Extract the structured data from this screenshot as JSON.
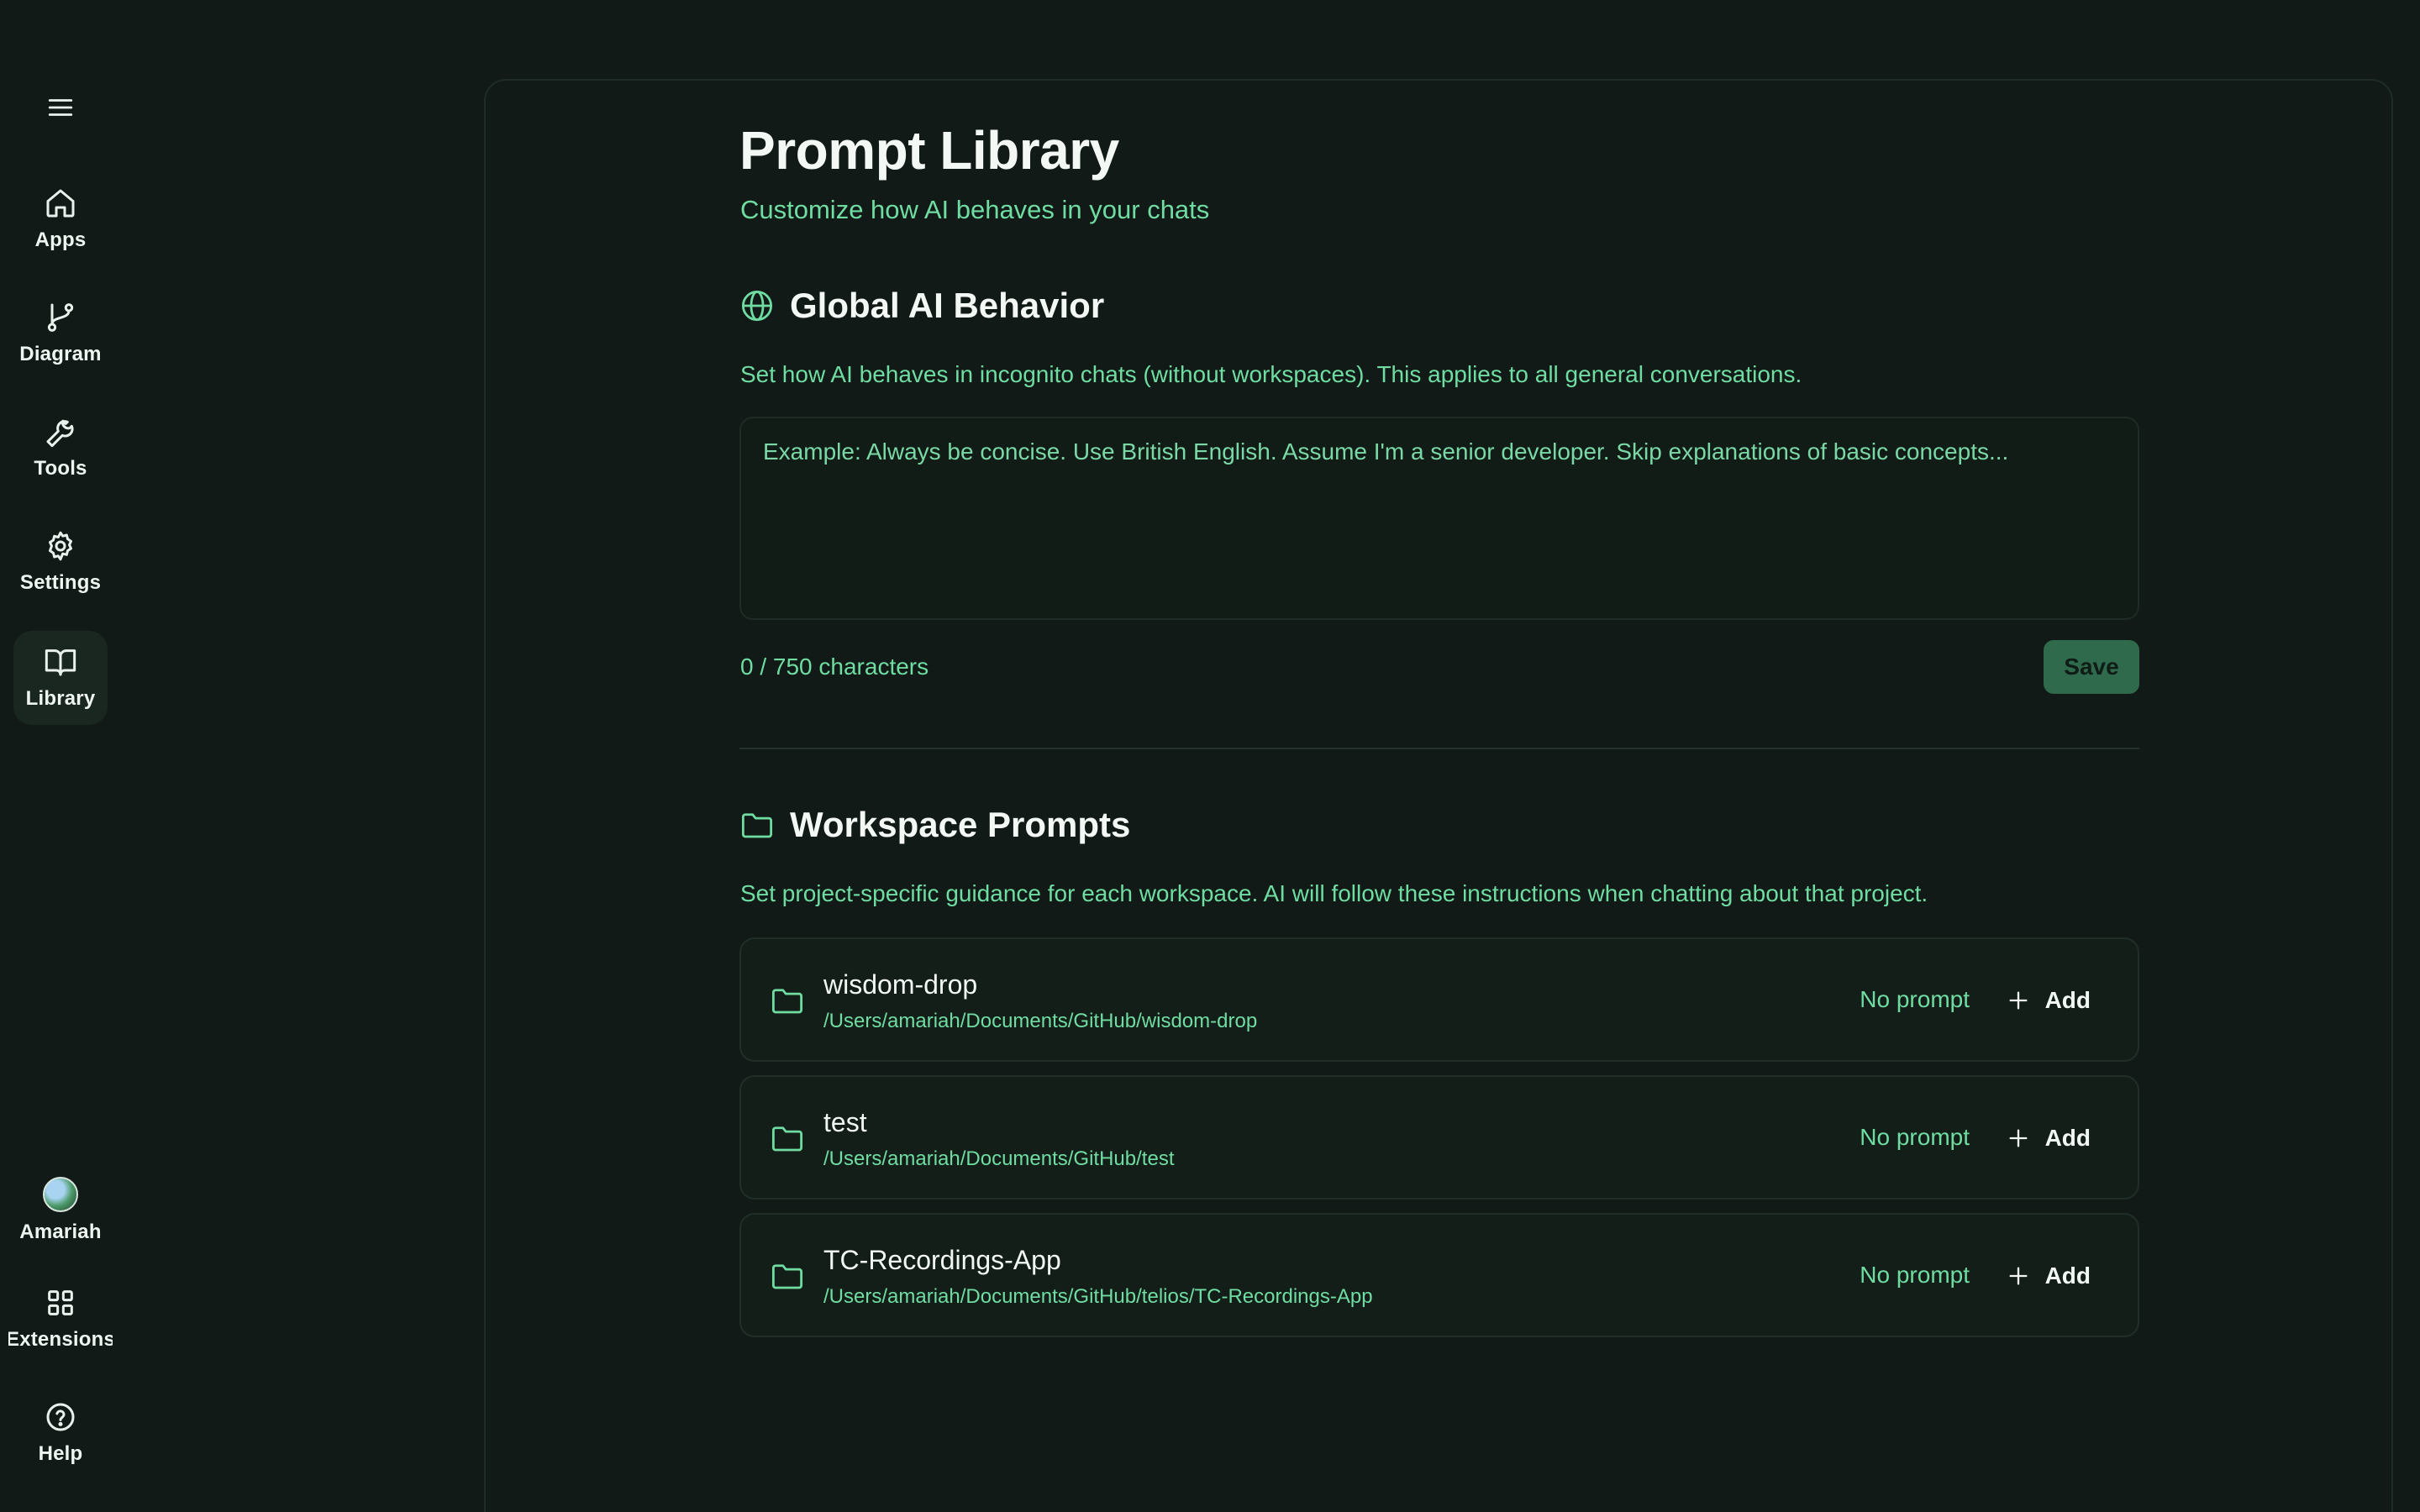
{
  "sidebar": {
    "items": [
      {
        "label": "Apps",
        "icon": "home-icon"
      },
      {
        "label": "Diagram",
        "icon": "git-branch-icon"
      },
      {
        "label": "Tools",
        "icon": "wrench-icon"
      },
      {
        "label": "Settings",
        "icon": "gear-icon"
      },
      {
        "label": "Library",
        "icon": "book-icon",
        "active": true
      }
    ],
    "user": {
      "label": "Amariah"
    },
    "extensions": {
      "label": "Extensions"
    },
    "help": {
      "label": "Help"
    }
  },
  "page": {
    "title": "Prompt Library",
    "subtitle": "Customize how AI behaves in your chats"
  },
  "global": {
    "title": "Global AI Behavior",
    "description": "Set how AI behaves in incognito chats (without workspaces). This applies to all general conversations.",
    "placeholder": "Example: Always be concise. Use British English. Assume I'm a senior developer. Skip explanations of basic concepts...",
    "value": "",
    "char_count": "0 / 750 characters",
    "save_label": "Save"
  },
  "workspaces": {
    "title": "Workspace Prompts",
    "description": "Set project-specific guidance for each workspace. AI will follow these instructions when chatting about that project.",
    "items": [
      {
        "name": "wisdom-drop",
        "path": "/Users/amariah/Documents/GitHub/wisdom-drop",
        "status": "No prompt",
        "action": "Add"
      },
      {
        "name": "test",
        "path": "/Users/amariah/Documents/GitHub/test",
        "status": "No prompt",
        "action": "Add"
      },
      {
        "name": "TC-Recordings-App",
        "path": "/Users/amariah/Documents/GitHub/telios/TC-Recordings-App",
        "status": "No prompt",
        "action": "Add"
      }
    ]
  },
  "colors": {
    "background": "#111a16",
    "accent": "#6fdca2",
    "save_button": "#2e6a4b"
  }
}
